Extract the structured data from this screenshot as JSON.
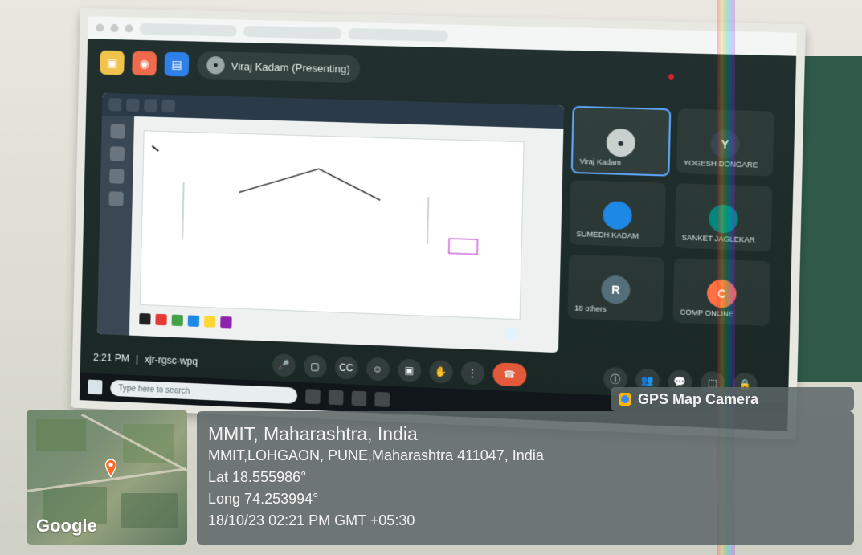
{
  "meeting_screen": {
    "presenter": "Viraj Kadam (Presenting)",
    "time": "2:21 PM",
    "meeting_code": "xjr-rgsc-wpq",
    "participants": [
      {
        "name": "Viraj Kadam",
        "initial": "",
        "color": "#c9d1ce"
      },
      {
        "name": "YOGESH DONGARE",
        "initial": "Y",
        "color": "#37474f"
      },
      {
        "name": "SUMEDH KADAM",
        "initial": "",
        "color": "#1e88e5"
      },
      {
        "name": "SANKET JAGLEKAR",
        "initial": "",
        "color": "#00897b"
      },
      {
        "name": "18 others",
        "initial": "R",
        "color": "#546e7a"
      },
      {
        "name": "COMP ONLINE",
        "initial": "C",
        "color": "#ff7043"
      }
    ],
    "taskbar_search_placeholder": "Type here to search"
  },
  "gps_overlay": {
    "badge_title": "GPS Map Camera",
    "location_title": "MMIT, Maharashtra, India",
    "address": "MMIT,LOHGAON, PUNE,Maharashtra 411047, India",
    "lat": "Lat 18.555986°",
    "long": "Long 74.253994°",
    "datetime": "18/10/23 02:21 PM GMT +05:30",
    "map_brand": "Google"
  },
  "colors": {
    "overlay_bg": "#5c6667",
    "accent_gps": "#ffb400",
    "end_call": "#e25a3a"
  }
}
